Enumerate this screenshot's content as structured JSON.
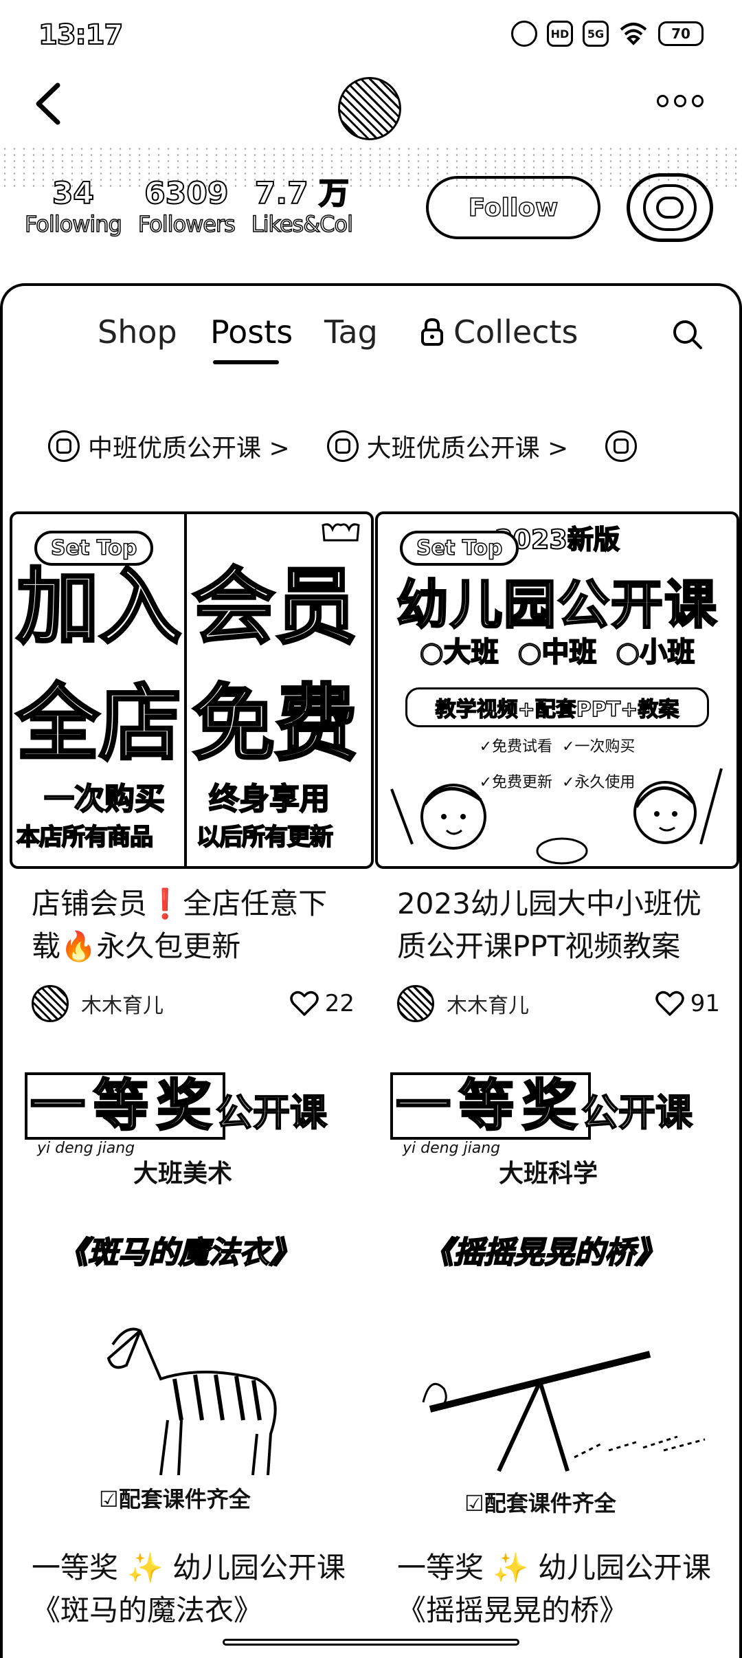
{
  "status": {
    "time": "13:17",
    "hd": "HD",
    "signal": "5G",
    "battery": "70"
  },
  "profile": {
    "stats": [
      {
        "num": "34",
        "label": "Following"
      },
      {
        "num": "6309",
        "label": "Followers"
      },
      {
        "num": "7.7 万",
        "label": "Likes&Col"
      }
    ],
    "follow_label": "Follow"
  },
  "tabs": [
    {
      "label": "Shop"
    },
    {
      "label": "Posts",
      "active": true
    },
    {
      "label": "Tag"
    },
    {
      "label": "Collects",
      "locked": true
    }
  ],
  "collections": [
    {
      "label": "中班优质公开课 >"
    },
    {
      "label": "大班优质公开课 >"
    }
  ],
  "posts": [
    {
      "badge": "Set Top",
      "cover": {
        "l1": "加入",
        "l2": "会员",
        "l3": "全店",
        "l4": "免费",
        "sub1": "一次购买",
        "sub2": "终身享用",
        "foot1": "本店所有商品",
        "foot2": "以后所有更新"
      },
      "title": "店铺会员❗全店任意下载🔥永久包更新",
      "author": "木木育儿",
      "likes": "22"
    },
    {
      "badge": "Set Top",
      "cover": {
        "year": "2023新版",
        "headline": "幼儿园公开课",
        "grades": "○大班  ○中班  ○小班",
        "banner": "教学视频+配套PPT+教案",
        "tags1": "✓免费试看  ✓一次购买",
        "tags2": "✓免费更新  ✓永久使用"
      },
      "title": "2023幼儿园大中小班优质公开课PPT视频教案",
      "author": "木木育儿",
      "likes": "91"
    },
    {
      "cover": {
        "award": "一等奖",
        "pinyin": "yi deng jiang",
        "kind": "公开课",
        "subject": "大班美术",
        "lesson": "《斑马的魔法衣》",
        "footer": "☑配套课件齐全"
      },
      "title": "一等奖 ✨ 幼儿园公开课《斑马的魔法衣》"
    },
    {
      "cover": {
        "award": "一等奖",
        "pinyin": "yi deng jiang",
        "kind": "公开课",
        "subject": "大班科学",
        "lesson": "《摇摇晃晃的桥》",
        "footer": "☑配套课件齐全"
      },
      "title": "一等奖 ✨ 幼儿园公开课《摇摇晃晃的桥》"
    }
  ]
}
